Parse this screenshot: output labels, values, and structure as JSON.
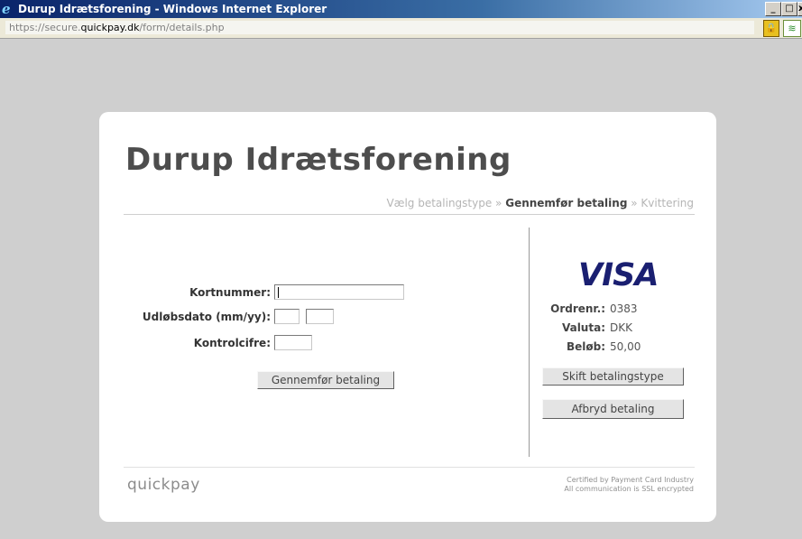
{
  "window": {
    "title": "Durup Idrætsforening - Windows Internet Explorer",
    "minimize_glyph": "_",
    "maximize_glyph": "□",
    "close_glyph": "x"
  },
  "address": {
    "url_scheme": "https://",
    "url_sub": "secure.",
    "url_domain": "quickpay.dk",
    "url_path": "/form/details.php"
  },
  "page": {
    "org_title": "Durup Idrætsforening",
    "steps": {
      "step1": "Vælg betalingstype",
      "sep1": " » ",
      "step2": "Gennemfør betaling",
      "sep2": " » ",
      "step3": "Kvittering"
    },
    "form": {
      "card_label": "Kortnummer:",
      "card_value": "",
      "expiry_label": "Udløbsdato (mm/yy):",
      "expiry_month": "",
      "expiry_year": "",
      "cvc_label": "Kontrolcifre:",
      "cvc_value": "",
      "submit_label": "Gennemfør betaling"
    },
    "summary": {
      "brand": "VISA",
      "order_label": "Ordrenr.:",
      "order_value": "0383",
      "currency_label": "Valuta:",
      "currency_value": "DKK",
      "amount_label": "Beløb:",
      "amount_value": "50,00",
      "change_type_label": "Skift betalingstype",
      "cancel_label": "Afbryd betaling"
    },
    "footer": {
      "logo_text": "quickpay",
      "line1": "Certified by Payment Card Industry",
      "line2": "All communication is SSL encrypted"
    }
  },
  "colors": {
    "visa_blue": "#1a1f71",
    "title_gray": "#4d4d4d",
    "page_bg": "#cfcfcf"
  }
}
